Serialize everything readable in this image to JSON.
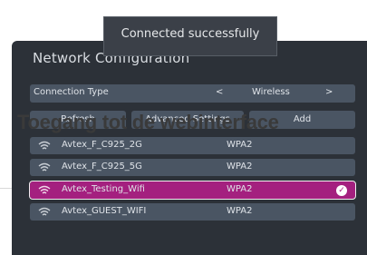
{
  "toast": {
    "message": "Connected successfully"
  },
  "dialog": {
    "title": "Network Configuration"
  },
  "connection": {
    "label": "Connection Type",
    "prev_arrow": "<",
    "value": "Wireless",
    "next_arrow": ">"
  },
  "buttons": {
    "refresh": "Refresh",
    "advanced": "Advanced Settings",
    "add": "Add"
  },
  "networks": [
    {
      "name": "Avtex_F_C925_2G",
      "security": "WPA2",
      "icon": "wifi-icon",
      "selected": false
    },
    {
      "name": "Avtex_F_C925_5G",
      "security": "WPA2",
      "icon": "wifi-icon",
      "selected": false
    },
    {
      "name": "Avtex_Testing_Wifi",
      "security": "WPA2",
      "icon": "wifi-icon",
      "selected": true
    },
    {
      "name": "Avtex_GUEST_WIFI",
      "security": "WPA2",
      "icon": "wifi-icon",
      "selected": false
    }
  ],
  "watermark": {
    "text": "Toegang tot de webinterface"
  },
  "colors": {
    "dialog_bg": "#2c3138",
    "row_bg": "#4a5563",
    "selected_bg": "#a4207f"
  }
}
